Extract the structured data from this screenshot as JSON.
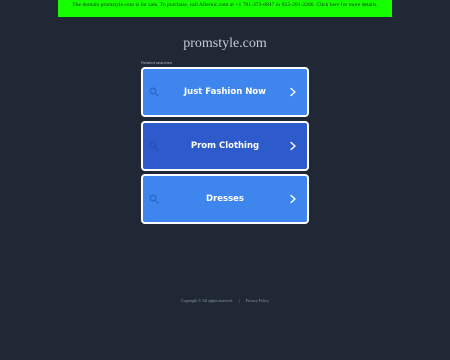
{
  "banner": {
    "text": "The domain promstyle.com is for sale. To purchase, call Afternic.com at +1 781-373-6847 or 855-201-2286. Click here for more details."
  },
  "header": {
    "domain_title": "promstyle.com"
  },
  "related": {
    "heading": "Related searches",
    "items": [
      {
        "label": "Just Fashion Now",
        "icon": "search-icon",
        "chevron": "chevron-right-icon"
      },
      {
        "label": "Prom Clothing",
        "icon": "search-icon",
        "chevron": "chevron-right-icon"
      },
      {
        "label": "Dresses",
        "icon": "search-icon",
        "chevron": "chevron-right-icon"
      }
    ]
  },
  "footer": {
    "copyright": "Copyright © All rights reserved.",
    "separator": "|",
    "privacy_label": "Privacy Policy"
  },
  "colors": {
    "background": "#1f2834",
    "banner": "#16ff00",
    "result_button": "#3f85ee",
    "result_button_hover": "#2e5bcb",
    "result_border": "#ffffff"
  }
}
